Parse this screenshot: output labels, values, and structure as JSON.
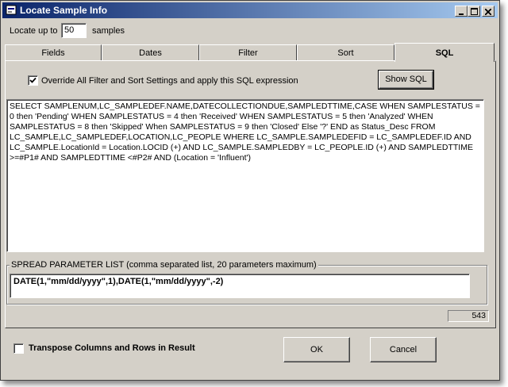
{
  "window": {
    "title": "Locate Sample Info"
  },
  "locate": {
    "prefix": "Locate up to",
    "value": "50",
    "suffix": "samples"
  },
  "tabs": [
    {
      "label": "Fields"
    },
    {
      "label": "Dates"
    },
    {
      "label": "Filter"
    },
    {
      "label": "Sort"
    },
    {
      "label": "SQL"
    }
  ],
  "sql_tab": {
    "override_label": "Override All Filter and Sort Settings and apply this SQL expression",
    "override_checked": true,
    "show_sql_label": "Show SQL",
    "sql_text": "SELECT SAMPLENUM,LC_SAMPLEDEF.NAME,DATECOLLECTIONDUE,SAMPLEDTTIME,CASE  WHEN SAMPLESTATUS = 0 then 'Pending' WHEN SAMPLESTATUS = 4 then 'Received' WHEN SAMPLESTATUS = 5 then 'Analyzed' WHEN SAMPLESTATUS = 8 then 'Skipped' When SAMPLESTATUS = 9 then 'Closed' Else '?' END as Status_Desc FROM LC_SAMPLE,LC_SAMPLEDEF,LOCATION,LC_PEOPLE WHERE LC_SAMPLE.SAMPLEDEFID = LC_SAMPLEDEF.ID AND LC_SAMPLE.LocationId = Location.LOCID (+) AND LC_SAMPLE.SAMPLEDBY = LC_PEOPLE.ID (+)  AND SAMPLEDTTIME >=#P1# AND SAMPLEDTTIME <#P2# AND (Location = 'Influent')",
    "spread_label": "SPREAD PARAMETER LIST (comma separated list, 20 parameters maximum)",
    "spread_value": "DATE(1,\"mm/dd/yyyy\",1),DATE(1,\"mm/dd/yyyy\",-2)",
    "count": "543"
  },
  "footer": {
    "transpose_label": "Transpose Columns and Rows in Result",
    "transpose_checked": false,
    "ok_label": "OK",
    "cancel_label": "Cancel"
  },
  "icons": {
    "window": "app-icon",
    "minimize": "minimize-icon",
    "maximize": "maximize-icon",
    "close": "close-icon",
    "check": "checkmark-icon"
  }
}
